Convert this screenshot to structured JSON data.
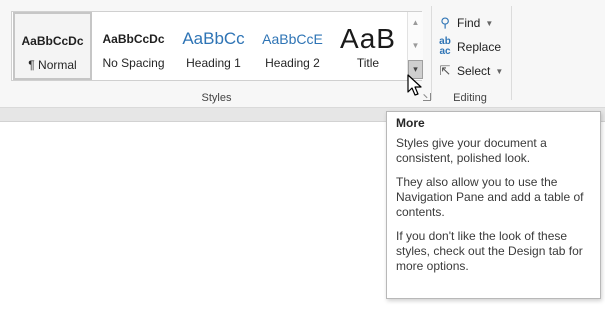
{
  "styles_gallery": {
    "items": [
      {
        "sample": "AaBbCcDc",
        "caption": "¶ Normal",
        "selected": true
      },
      {
        "sample": "AaBbCcDc",
        "caption": "No Spacing",
        "selected": false
      },
      {
        "sample": "AaBbCc",
        "caption": "Heading 1",
        "selected": false
      },
      {
        "sample": "AaBbCcE",
        "caption": "Heading 2",
        "selected": false
      },
      {
        "sample": "AaB",
        "caption": "Title",
        "selected": false
      }
    ],
    "group_label": "Styles"
  },
  "editing": {
    "find_label": "Find",
    "replace_label": "Replace",
    "select_label": "Select",
    "group_label": "Editing",
    "find_icon": "search-icon",
    "replace_icon": "replace-icon",
    "select_icon": "cursor-select-icon"
  },
  "tooltip": {
    "title": "More",
    "paragraphs": [
      "Styles give your document a consistent, polished look.",
      "They also allow you to use the Navigation Pane and add a table of contents.",
      "If you don't like the look of these styles, check out the Design tab for more options."
    ]
  },
  "colors": {
    "ribbon_bg": "#f7f7f7",
    "heading_blue": "#2e74b5",
    "tooltip_border": "#b8b8b8"
  }
}
